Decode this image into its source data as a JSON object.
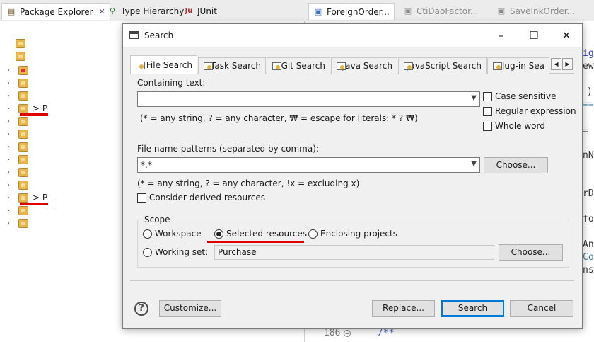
{
  "ide": {
    "tabs": [
      {
        "label": "Package Explorer",
        "icon": "package-explorer-icon"
      },
      {
        "label": "Type Hierarchy",
        "icon": "type-hierarchy-icon"
      },
      {
        "label": "JUnit",
        "icon": "junit-icon",
        "icon_text": "Ju"
      }
    ],
    "editor_tabs": [
      {
        "label": "ForeignOrder..."
      },
      {
        "label": "CtiDaoFactor..."
      },
      {
        "label": "SaveInkOrder..."
      }
    ],
    "tree_labels": [
      "> P",
      "> P"
    ],
    "line_number": "186",
    "comment_text": "/**",
    "code_fragments": [
      "ig",
      "ew",
      ")",
      "==",
      "=",
      "nN",
      "rD",
      "fo",
      "An",
      "Co",
      "ns"
    ]
  },
  "dialog": {
    "title": "Search",
    "tabs": [
      {
        "label": "File Search"
      },
      {
        "label": "Task Search"
      },
      {
        "label": "Git Search"
      },
      {
        "label": "Java Search"
      },
      {
        "label": "JavaScript Search"
      },
      {
        "label": "Plug-in Sea"
      }
    ],
    "containing_text": {
      "label": "Containing text:",
      "value": "",
      "hint": "(* = any string, ? = any character, ₩ = escape for literals: * ? ₩)"
    },
    "options": {
      "case_sensitive": "Case sensitive",
      "regular_expression": "Regular expression",
      "whole_word": "Whole word"
    },
    "file_patterns": {
      "label": "File name patterns (separated by comma):",
      "value": "*.*",
      "choose": "Choose...",
      "hint": "(* = any string, ? = any character, !x = excluding x)"
    },
    "consider_derived": "Consider derived resources",
    "scope": {
      "label": "Scope",
      "workspace": "Workspace",
      "selected_resources": "Selected resources",
      "enclosing_projects": "Enclosing projects",
      "working_set": "Working set:",
      "working_set_value": "Purchase",
      "choose": "Choose...",
      "selected": "selected_resources"
    },
    "buttons": {
      "customize": "Customize...",
      "replace": "Replace...",
      "search": "Search",
      "cancel": "Cancel"
    }
  },
  "colors": {
    "highlight_red": "#e00000",
    "default_button_border": "#0078d7"
  }
}
